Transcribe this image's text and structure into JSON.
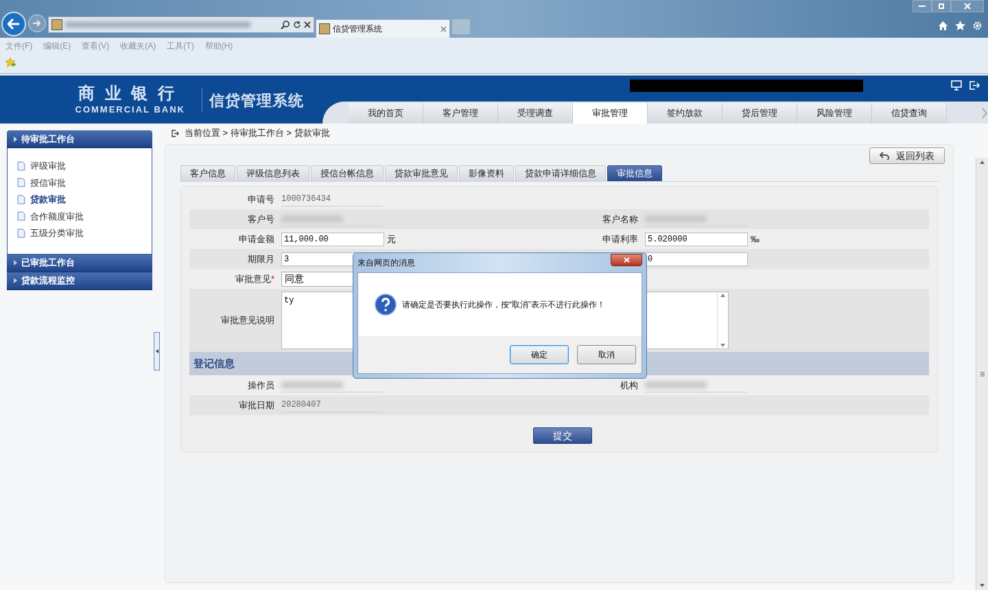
{
  "browser": {
    "tab_title": "信贷管理系统",
    "menu": [
      "文件(F)",
      "编辑(E)",
      "查看(V)",
      "收藏夹(A)",
      "工具(T)",
      "帮助(H)"
    ]
  },
  "header": {
    "bank_name": "商 业 银 行",
    "bank_name_en": "COMMERCIAL BANK",
    "system_name": "信贷管理系统"
  },
  "nav": [
    {
      "label": "我的首页",
      "selected": false
    },
    {
      "label": "客户管理",
      "selected": false
    },
    {
      "label": "受理调查",
      "selected": false
    },
    {
      "label": "审批管理",
      "selected": true
    },
    {
      "label": "签约放款",
      "selected": false
    },
    {
      "label": "贷后管理",
      "selected": false
    },
    {
      "label": "风险管理",
      "selected": false
    },
    {
      "label": "信贷查询",
      "selected": false
    }
  ],
  "sidebar": [
    {
      "label": "待审批工作台",
      "expanded": true,
      "items": [
        {
          "label": "评级审批",
          "selected": false
        },
        {
          "label": "授信审批",
          "selected": false
        },
        {
          "label": "贷款审批",
          "selected": true
        },
        {
          "label": "合作额度审批",
          "selected": false
        },
        {
          "label": "五级分类审批",
          "selected": false
        }
      ]
    },
    {
      "label": "已审批工作台",
      "expanded": false
    },
    {
      "label": "贷款流程监控",
      "expanded": false
    }
  ],
  "breadcrumb": "当前位置 > 待审批工作台 > 贷款审批",
  "back_button": "返回列表",
  "tabs": [
    {
      "label": "客户信息",
      "selected": false
    },
    {
      "label": "评级信息列表",
      "selected": false
    },
    {
      "label": "授信台帐信息",
      "selected": false
    },
    {
      "label": "贷款审批意见",
      "selected": false
    },
    {
      "label": "影像资料",
      "selected": false
    },
    {
      "label": "贷款申请详细信息",
      "selected": false
    },
    {
      "label": "审批信息",
      "selected": true
    }
  ],
  "form": {
    "rows": [
      {
        "fields": [
          {
            "kind": "text",
            "label": "申请号",
            "value": "1000736434"
          }
        ]
      },
      {
        "fields": [
          {
            "kind": "blurred",
            "label": "客户号"
          },
          {
            "kind": "blurred",
            "label": "客户名称"
          }
        ]
      },
      {
        "fields": [
          {
            "kind": "input",
            "label": "申请金额",
            "value": "11,000.00",
            "unit": "元"
          },
          {
            "kind": "input",
            "label": "申请利率",
            "value": "5.020000",
            "unit": "‰"
          }
        ]
      },
      {
        "fields": [
          {
            "kind": "input",
            "label": "期限月",
            "value": "3"
          },
          {
            "kind": "input",
            "value": "0"
          }
        ]
      },
      {
        "fields": [
          {
            "kind": "select",
            "label": "审批意见",
            "required_mark": "*",
            "value": "同意"
          }
        ]
      },
      {
        "fields": [
          {
            "kind": "textarea",
            "label": "审批意见说明",
            "value": "ty"
          }
        ]
      },
      {
        "section": "登记信息"
      },
      {
        "fields": [
          {
            "kind": "blurred",
            "label": "操作员"
          },
          {
            "kind": "blurred",
            "label": "机构"
          }
        ]
      },
      {
        "fields": [
          {
            "kind": "text",
            "label": "审批日期",
            "value": "20280407"
          }
        ]
      }
    ],
    "submit": "提交"
  },
  "dialog": {
    "title": "来自网页的消息",
    "message": "请确定是否要执行此操作，按“取消”表示不进行此操作！",
    "buttons": [
      {
        "label": "确定",
        "selected": true
      },
      {
        "label": "取消",
        "selected": false
      }
    ]
  }
}
